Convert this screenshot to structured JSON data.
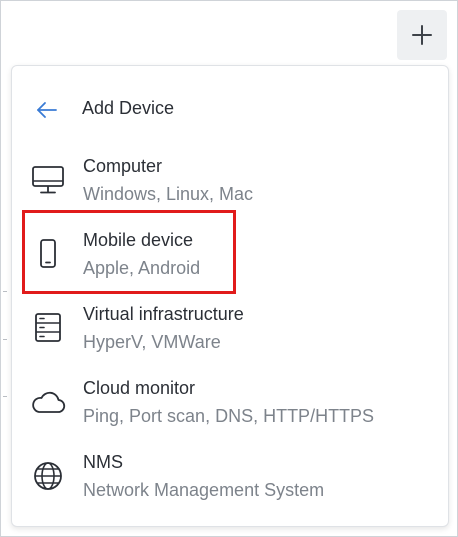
{
  "header": {
    "title": "Add Device",
    "back_icon": "arrow-left-icon",
    "add_icon": "plus-icon"
  },
  "devices": [
    {
      "name": "Computer",
      "description": "Windows, Linux, Mac",
      "icon": "monitor-icon"
    },
    {
      "name": "Mobile device",
      "description": "Apple, Android",
      "icon": "smartphone-icon",
      "highlighted": true
    },
    {
      "name": "Virtual infrastructure",
      "description": "HyperV, VMWare",
      "icon": "server-icon"
    },
    {
      "name": "Cloud monitor",
      "description": "Ping, Port scan, DNS, HTTP/HTTPS",
      "icon": "cloud-icon"
    },
    {
      "name": "NMS",
      "description": "Network Management System",
      "icon": "globe-icon"
    }
  ],
  "colors": {
    "accent": "#3a7bd5",
    "highlight": "#e11b1b",
    "text": "#2b2f36",
    "muted": "#7d838b"
  }
}
